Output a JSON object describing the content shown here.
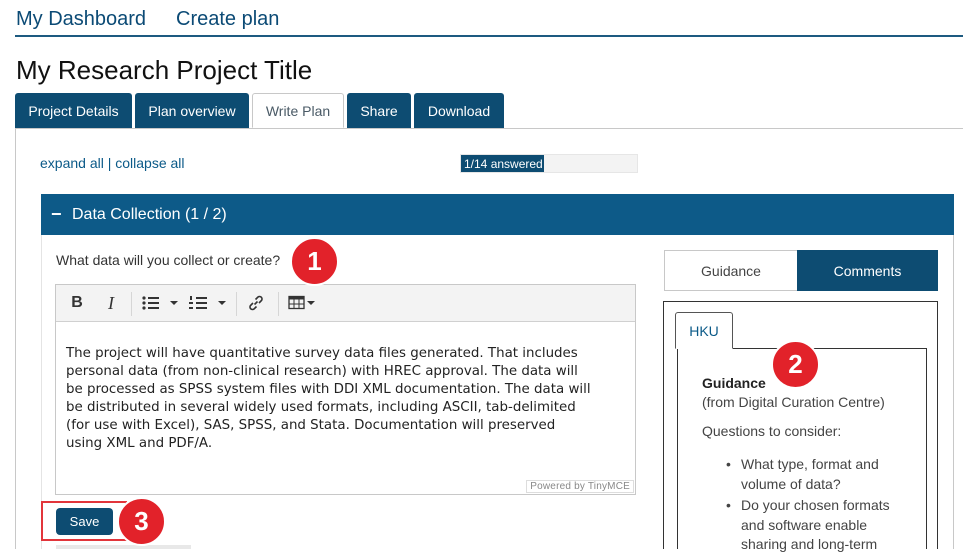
{
  "topnav": {
    "dashboard": "My Dashboard",
    "create_plan": "Create plan"
  },
  "page_title": "My Research Project Title",
  "tabs": [
    {
      "label": "Project Details"
    },
    {
      "label": "Plan overview"
    },
    {
      "label": "Write Plan",
      "active": true
    },
    {
      "label": "Share"
    },
    {
      "label": "Download"
    }
  ],
  "expand": {
    "expand_all": "expand all",
    "separator": "|",
    "collapse_all": "collapse all"
  },
  "progress": {
    "text": "1/14 answered",
    "fraction": 0.4719
  },
  "section": {
    "toggle": "−",
    "title": "Data Collection (1 / 2)"
  },
  "question": "What data will you collect or create?",
  "editor": {
    "toolbar": {
      "bold": "B",
      "italic": "I"
    },
    "lines": [
      "The project will have quantitative survey data files generated. That includes",
      "personal data (from non-clinical research) with HREC approval. The data will",
      "be processed as SPSS system files with DDI XML documentation. The data will",
      "be distributed in several widely used formats, including ASCII, tab-delimited",
      "(for use with Excel), SAS, SPSS, and Stata. Documentation will preserved",
      "using XML and PDF/A."
    ],
    "powered": "Powered by TinyMCE"
  },
  "save_label": "Save",
  "guidance_tabs": {
    "guidance": "Guidance",
    "comments": "Comments"
  },
  "guidance": {
    "org_tab": "HKU",
    "heading": "Guidance",
    "source": "(from Digital Curation Centre)",
    "questions_label": "Questions to consider:",
    "items": [
      [
        "What type, format and",
        "volume of data?"
      ],
      [
        "Do your chosen formats",
        "and software enable",
        "sharing and long-term"
      ]
    ]
  },
  "badges": [
    "1",
    "2",
    "3"
  ],
  "colors": {
    "brand": "#0d4c72",
    "section": "#0d5a88",
    "badge": "#e2222a",
    "highlight": "#e2353b"
  }
}
